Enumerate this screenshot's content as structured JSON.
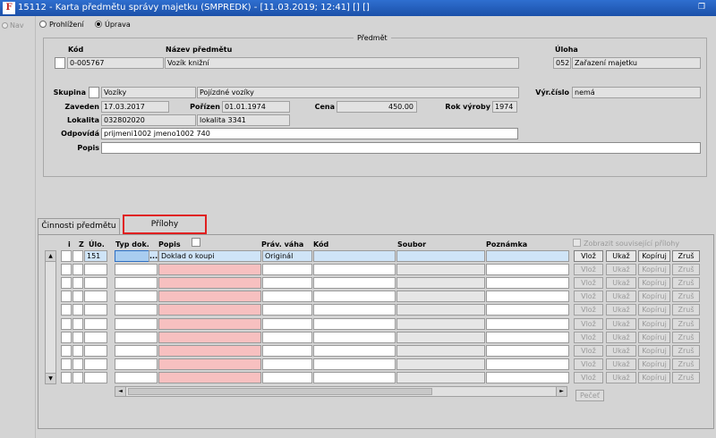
{
  "window": {
    "title": "15112 - Karta předmětu správy majetku (SMPREDK) - [11.03.2019; 12:41] [] []",
    "logo_text": "F"
  },
  "nav": {
    "label": "Nav"
  },
  "mode": {
    "options": [
      "Prohlížení",
      "Úprava"
    ],
    "selected": "Úprava"
  },
  "predmet": {
    "group_label": "Předmět",
    "kod_label": "Kód",
    "kod_value": "0-005767",
    "nazev_label": "Název předmětu",
    "nazev_value": "Vozík knižní",
    "uloha_label": "Úloha",
    "uloha_code": "052",
    "uloha_value": "Zařazení majetku"
  },
  "details": {
    "skupina_label": "Skupina",
    "skupina_value": "Vozíky",
    "skupina_desc": "Pojízdné vozíky",
    "vyr_cislo_label": "Výr.číslo",
    "vyr_cislo_value": "nemá",
    "zaveden_label": "Zaveden",
    "zaveden_value": "17.03.2017",
    "porizen_label": "Pořízen",
    "porizen_value": "01.01.1974",
    "cena_label": "Cena",
    "cena_value": "450.00",
    "rok_vyroby_label": "Rok výroby",
    "rok_vyroby_value": "1974",
    "lokalita_label": "Lokalita",
    "lokalita_code": "032802020",
    "lokalita_value": "lokalita 3341",
    "odpovida_label": "Odpovídá",
    "odpovida_value": "prijmeni1002 jmeno1002 740",
    "popis_label": "Popis",
    "popis_value": ""
  },
  "tabs": [
    {
      "label": "Činnosti předmětu"
    },
    {
      "label": "Přílohy"
    }
  ],
  "grid": {
    "headers": {
      "i": "i",
      "z": "Z",
      "ulo": "Úlo.",
      "typ_dok": "Typ dok.",
      "popis": "Popis",
      "prav_vaha": "Práv. váha",
      "kod": "Kód",
      "soubor": "Soubor",
      "poznamka": "Poznámka"
    },
    "show_related_label": "Zobrazit související přílohy",
    "first_row": {
      "ulo": "151",
      "typ_dok": "",
      "ellipsis": "...",
      "popis": "Doklad o koupi",
      "prav_vaha": "Originál"
    },
    "row_buttons": [
      "Vlož",
      "Ukaž",
      "Kopíruj",
      "Zruš"
    ],
    "pecet_label": "Pečeť"
  },
  "icons": {
    "scroll_up": "▲",
    "scroll_down": "▼",
    "scroll_left": "◄",
    "scroll_right": "►",
    "restore": "🗗"
  }
}
